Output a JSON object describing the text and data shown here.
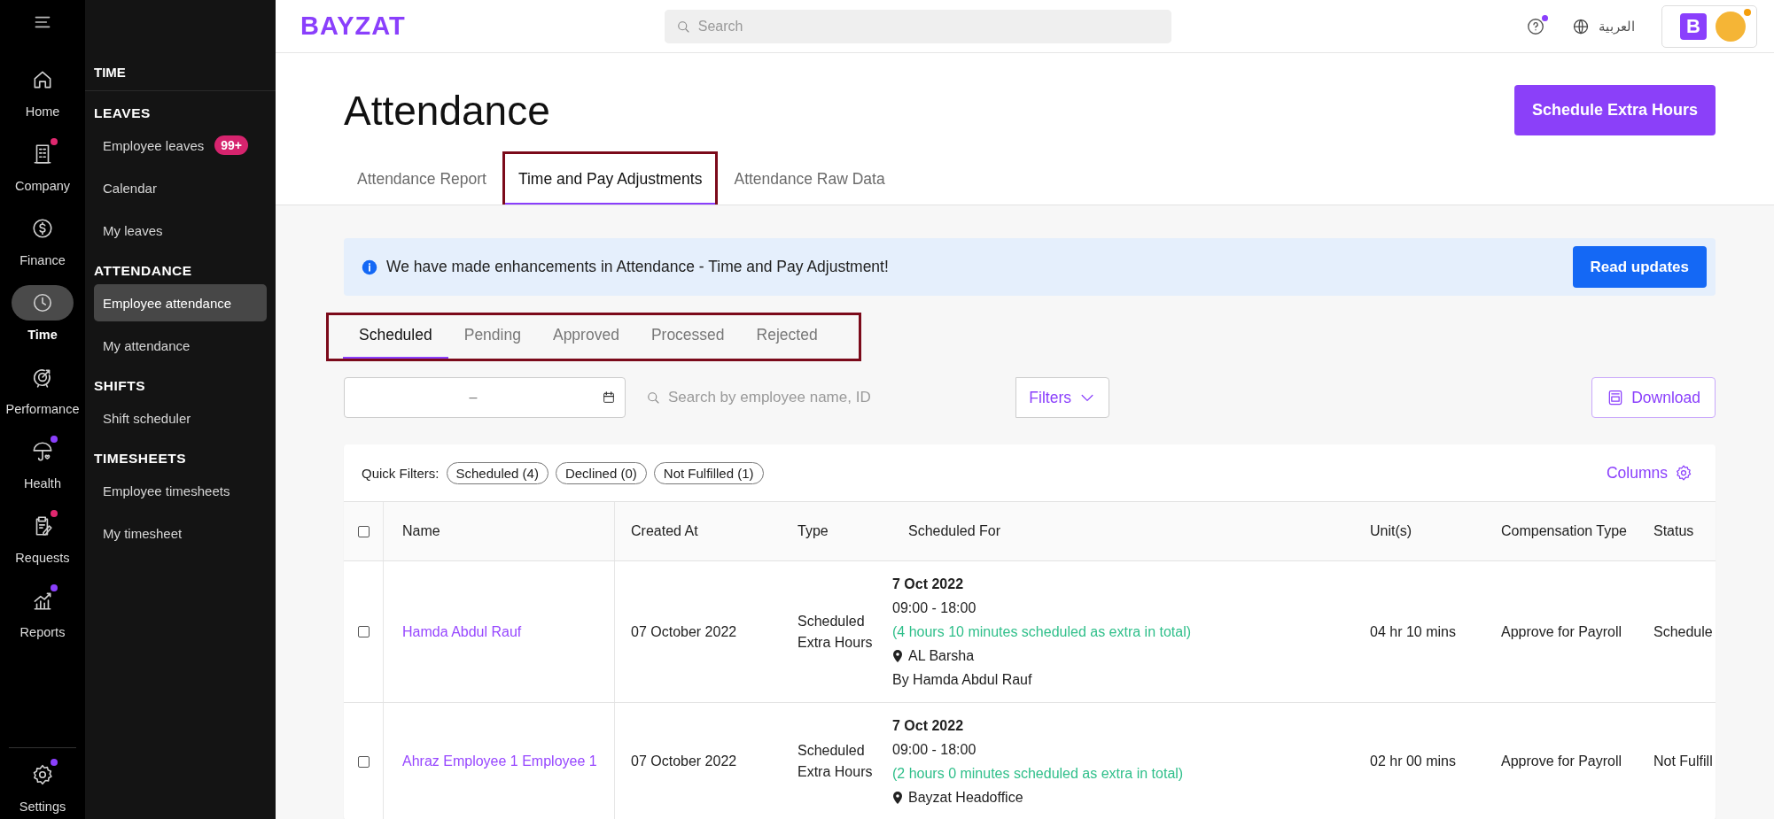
{
  "rail": {
    "items": [
      {
        "kind": "home",
        "label": "Home",
        "selected": false
      },
      {
        "kind": "building",
        "label": "Company",
        "selected": false,
        "color": "#e0286f"
      },
      {
        "kind": "dollar",
        "label": "Finance",
        "selected": false
      },
      {
        "kind": "clock",
        "label": "Time",
        "selected": true
      },
      {
        "kind": "target",
        "label": "Performance",
        "selected": false
      },
      {
        "kind": "umbrella",
        "label": "Health",
        "selected": false,
        "color": "#8a3ffc"
      },
      {
        "kind": "clipboard",
        "label": "Requests",
        "selected": false,
        "color": "#e0286f"
      },
      {
        "kind": "chart",
        "label": "Reports",
        "selected": false,
        "color": "#8a3ffc"
      }
    ],
    "footer": {
      "kind": "gear",
      "label": "Settings",
      "selected": false,
      "color": "#8a3ffc"
    }
  },
  "subnav": {
    "title": "TIME",
    "sections": [
      {
        "heading": "LEAVES",
        "items": [
          {
            "label": "Employee leaves",
            "badge": "99+",
            "selected": false
          },
          {
            "label": "Calendar",
            "selected": false
          },
          {
            "label": "My leaves",
            "selected": false
          }
        ]
      },
      {
        "heading": "ATTENDANCE",
        "items": [
          {
            "label": "Employee attendance",
            "selected": true
          },
          {
            "label": "My attendance",
            "selected": false
          }
        ]
      },
      {
        "heading": "SHIFTS",
        "items": [
          {
            "label": "Shift scheduler",
            "selected": false
          }
        ]
      },
      {
        "heading": "TIMESHEETS",
        "items": [
          {
            "label": "Employee timesheets",
            "selected": false
          },
          {
            "label": "My timesheet",
            "selected": false
          }
        ]
      }
    ]
  },
  "header": {
    "logo": "BAYZAT",
    "search": {
      "placeholder": "Search"
    },
    "help": {
      "notification": true
    },
    "language": "العربية",
    "account": {
      "letter": "B",
      "notification": true
    }
  },
  "page": {
    "title": "Attendance",
    "action_button": "Schedule Extra Hours",
    "tabs": [
      {
        "label": "Attendance Report",
        "selected": false,
        "highlighted": false
      },
      {
        "label": "Time and Pay Adjustments",
        "selected": true,
        "highlighted": true
      },
      {
        "label": "Attendance Raw Data",
        "selected": false,
        "highlighted": false
      }
    ]
  },
  "banner": {
    "text": "We have made enhancements in Attendance - Time and Pay Adjustment!",
    "button": "Read updates"
  },
  "status_tabs": {
    "highlighted": true,
    "items": [
      {
        "label": "Scheduled",
        "selected": true
      },
      {
        "label": "Pending",
        "selected": false
      },
      {
        "label": "Approved",
        "selected": false
      },
      {
        "label": "Processed",
        "selected": false
      },
      {
        "label": "Rejected",
        "selected": false
      }
    ]
  },
  "filters": {
    "date_range": {
      "value": "–"
    },
    "search": {
      "placeholder": "Search by employee name, ID"
    },
    "filters_button": "Filters",
    "download_button": "Download"
  },
  "table": {
    "quick_filters_label": "Quick Filters:",
    "quick_filters": [
      "Scheduled (4)",
      "Declined (0)",
      "Not Fulfilled (1)"
    ],
    "columns_button": "Columns",
    "select_all_checked": false,
    "columns": [
      "Name",
      "Created At",
      "Type",
      "Scheduled For",
      "Unit(s)",
      "Compensation Type",
      "Status"
    ],
    "rows": [
      {
        "checked": false,
        "name": "Hamda Abdul Rauf",
        "created_at": "07 October 2022",
        "type": "Scheduled Extra Hours",
        "scheduled_for": {
          "date": "7 Oct 2022",
          "time": "09:00 - 18:00",
          "total": "(4 hours 10 minutes scheduled as extra in total)",
          "location": "AL Barsha",
          "by": "By Hamda Abdul Rauf"
        },
        "units": "04 hr 10 mins",
        "compensation": "Approve for Payroll",
        "status": "Schedule"
      },
      {
        "checked": false,
        "name": "Ahraz Employee 1 Employee 1",
        "created_at": "07 October 2022",
        "type": "Scheduled Extra Hours",
        "scheduled_for": {
          "date": "7 Oct 2022",
          "time": "09:00 - 18:00",
          "total": "(2 hours 0 minutes scheduled as extra in total)",
          "location": "Bayzat Headoffice"
        },
        "units": "02 hr 00 mins",
        "compensation": "Approve for Payroll",
        "status": "Not Fulfill"
      }
    ]
  }
}
